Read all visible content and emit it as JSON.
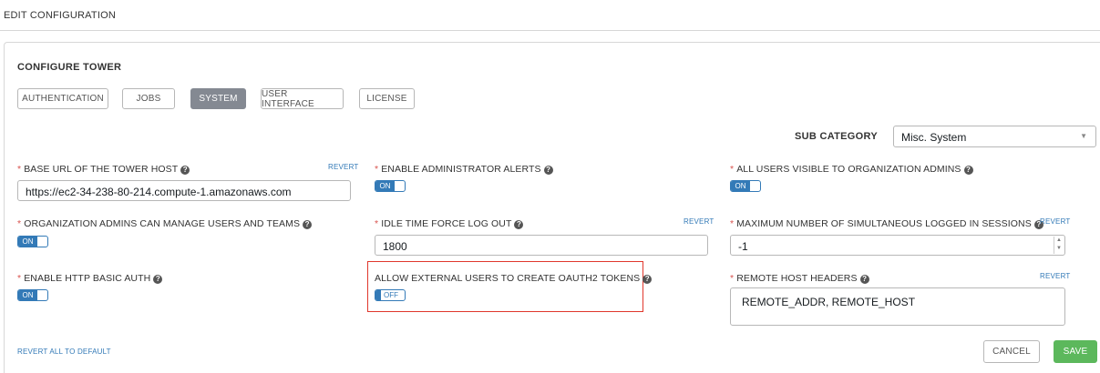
{
  "header": {
    "title": "EDIT CONFIGURATION"
  },
  "panel": {
    "title": "CONFIGURE TOWER"
  },
  "tabs": [
    {
      "label": "AUTHENTICATION",
      "active": false
    },
    {
      "label": "JOBS",
      "active": false
    },
    {
      "label": "SYSTEM",
      "active": true
    },
    {
      "label": "USER INTERFACE",
      "active": false
    },
    {
      "label": "LICENSE",
      "active": false
    }
  ],
  "sub_category": {
    "label": "SUB CATEGORY",
    "value": "Misc. System"
  },
  "fields": {
    "base_url": {
      "label": "BASE URL OF THE TOWER HOST",
      "value": "https://ec2-34-238-80-214.compute-1.amazonaws.com",
      "revert": "REVERT"
    },
    "admin_alerts": {
      "label": "ENABLE ADMINISTRATOR ALERTS",
      "state": "ON"
    },
    "all_users_visible": {
      "label": "ALL USERS VISIBLE TO ORGANIZATION ADMINS",
      "state": "ON"
    },
    "org_admins_manage": {
      "label": "ORGANIZATION ADMINS CAN MANAGE USERS AND TEAMS",
      "state": "ON"
    },
    "idle_timeout": {
      "label": "IDLE TIME FORCE LOG OUT",
      "value": "1800",
      "revert": "REVERT"
    },
    "max_sessions": {
      "label": "MAXIMUM NUMBER OF SIMULTANEOUS LOGGED IN SESSIONS",
      "value": "-1",
      "revert": "REVERT"
    },
    "http_basic_auth": {
      "label": "ENABLE HTTP BASIC AUTH",
      "state": "ON"
    },
    "oauth2_tokens": {
      "label": "ALLOW EXTERNAL USERS TO CREATE OAUTH2 TOKENS",
      "state": "OFF"
    },
    "remote_host_headers": {
      "label": "REMOTE HOST HEADERS",
      "value": "REMOTE_ADDR, REMOTE_HOST",
      "revert": "REVERT"
    }
  },
  "footer": {
    "revert_all": "REVERT ALL TO DEFAULT",
    "cancel": "CANCEL",
    "save": "SAVE"
  },
  "colors": {
    "accent": "#337ab7",
    "save": "#5cb85c",
    "required": "#d9534f",
    "highlight": "#e0372c",
    "active_tab": "#848992"
  }
}
